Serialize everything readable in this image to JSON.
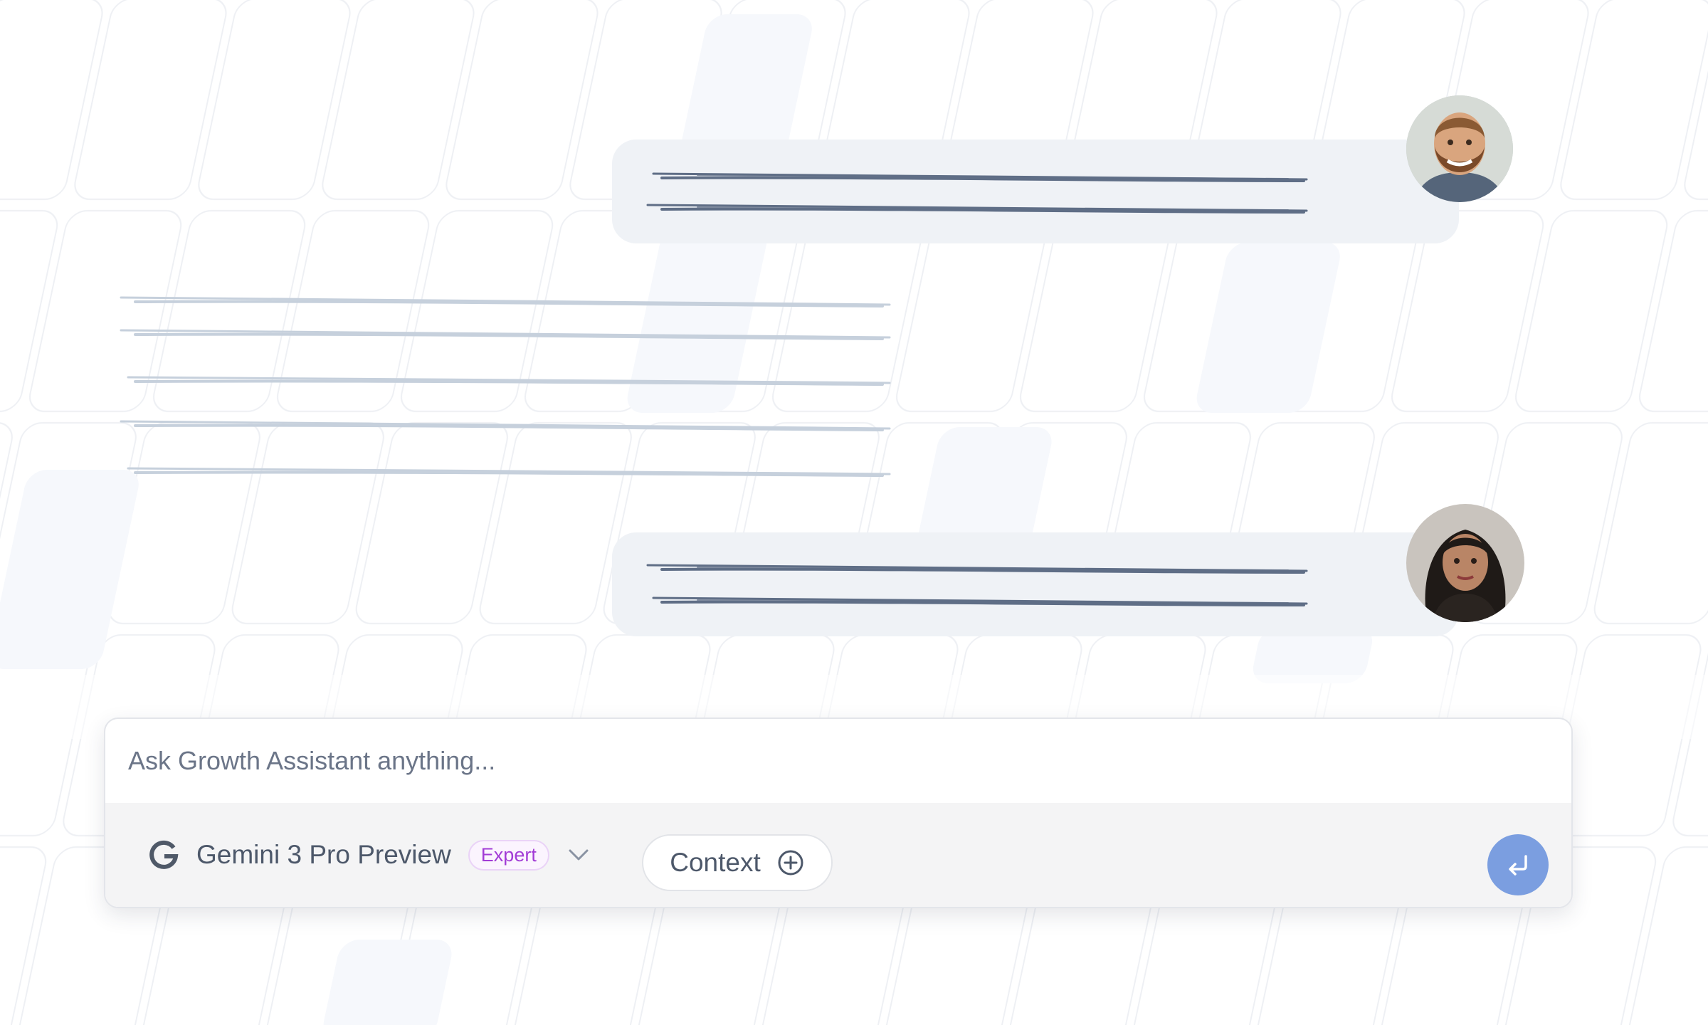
{
  "composer": {
    "placeholder": "Ask Growth Assistant anything...",
    "model": {
      "icon": "google-g-icon",
      "name": "Gemini 3 Pro Preview",
      "badge": "Expert"
    },
    "context_label": "Context",
    "send_icon": "enter-return-icon"
  },
  "conversation": [
    {
      "role": "user",
      "avatar": "man-with-beard-avatar",
      "text_lines": 2
    },
    {
      "role": "assistant",
      "text_lines": 5
    },
    {
      "role": "user",
      "avatar": "woman-avatar",
      "text_lines": 2
    }
  ],
  "colors": {
    "send_button": "#7b9ee0",
    "badge_text": "#a23cd6",
    "bubble": "#eff2f6",
    "user_scribble": "#5f6e86",
    "assistant_scribble": "#c6d0dc"
  }
}
